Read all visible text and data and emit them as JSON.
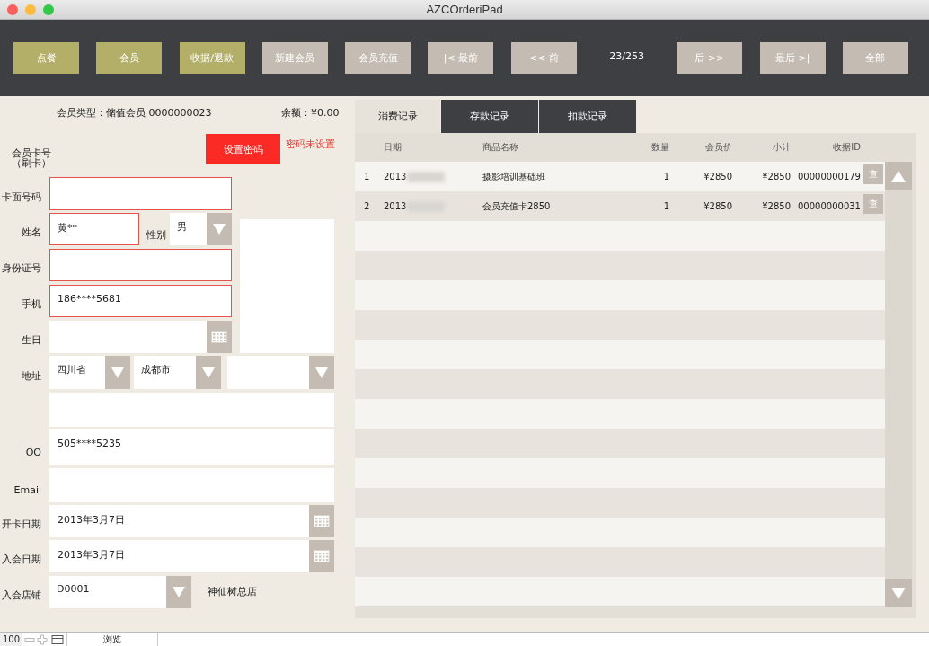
{
  "window": {
    "title": "AZCOrderiPad"
  },
  "toolbar": [
    {
      "label": "点餐",
      "kind": "module"
    },
    {
      "label": "会员",
      "kind": "module"
    },
    {
      "label": "收据/退款",
      "kind": "module"
    },
    {
      "label": "新建会员",
      "kind": "nav"
    },
    {
      "label": "会员充值",
      "kind": "nav"
    },
    {
      "label": "|< 最前",
      "kind": "nav"
    },
    {
      "label": "<< 前",
      "kind": "nav"
    },
    {
      "label": "23/253",
      "kind": "counter"
    },
    {
      "label": "后 >>",
      "kind": "nav"
    },
    {
      "label": "最后 >|",
      "kind": "nav"
    },
    {
      "label": "全部",
      "kind": "nav"
    }
  ],
  "member": {
    "type_info": "会员类型：储值会员 0000000023",
    "balance": "余额：¥0.00",
    "card_label": [
      "会员卡号",
      "（刷卡）"
    ],
    "password_button": "设置密码",
    "password_status": "密码未设置"
  },
  "form": {
    "card_face": {
      "label": "卡面号码",
      "required": true
    },
    "name": {
      "label": "姓名",
      "value": "黄**",
      "required": true
    },
    "gender": {
      "label": "性别",
      "value": "男"
    },
    "id_number": {
      "label": "身份证号",
      "required": true
    },
    "mobile": {
      "label": "手机",
      "value": "186****5681",
      "required": true
    },
    "birthday": {
      "label": "生日",
      "required": false
    },
    "address": {
      "label": "地址",
      "province": "四川省",
      "city": "成都市"
    },
    "address_detail": {
      "required": false
    },
    "qq": {
      "label": "QQ",
      "value": "505****5235",
      "required": false
    },
    "email": {
      "label": "Email",
      "required": false
    },
    "open_date": {
      "label": "开卡日期",
      "value": "2013年3月7日"
    },
    "join_date": {
      "label": "入会日期",
      "value": "2013年3月7日"
    },
    "store": {
      "label": "入会店铺",
      "value": "D0001",
      "store_name": "神仙树总店"
    }
  },
  "tabs": [
    {
      "label": "消费记录",
      "selected": true
    },
    {
      "label": "存款记录",
      "selected": false
    },
    {
      "label": "扣款记录",
      "selected": false
    }
  ],
  "table": {
    "columns": [
      "日期",
      "商品名称",
      "数量",
      "会员价",
      "小计",
      "收据ID"
    ],
    "rows": [
      {
        "index": "1",
        "date": "2013",
        "item": "摄影培训基础班",
        "qty": "1",
        "price": "¥2850",
        "subtotal": "¥2850",
        "receipt_id": "00000000179",
        "action": "查"
      },
      {
        "index": "2",
        "date": "2013",
        "item": "会员充值卡2850",
        "qty": "1",
        "price": "¥2850",
        "subtotal": "¥2850",
        "receipt_id": "00000000031",
        "action": "查"
      }
    ]
  },
  "status_bar": {
    "zoom": "100",
    "mode": "浏览"
  }
}
